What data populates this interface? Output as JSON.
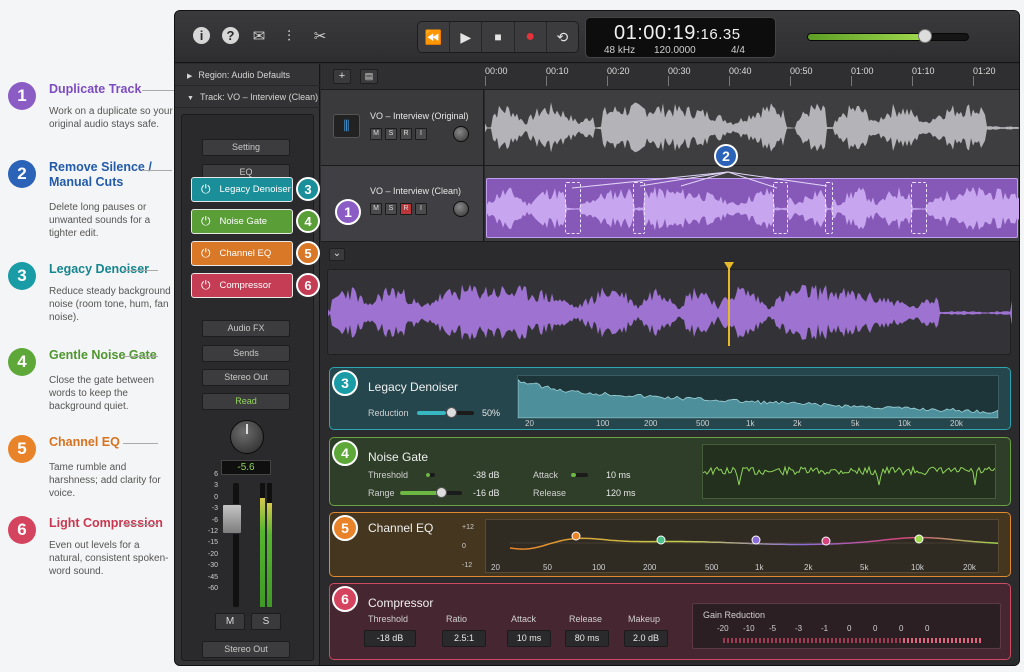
{
  "guide": [
    {
      "num": "1",
      "title": "Duplicate Track",
      "desc": "Work on a duplicate so your original audio stays safe.",
      "color": "#8c5cc5",
      "tcolor": "#7c4cc0"
    },
    {
      "num": "2",
      "title": "Remove Silence / Manual Cuts",
      "desc": "Delete long pauses or unwanted sounds for a tighter edit.",
      "color": "#2a63b7",
      "tcolor": "#235ba8"
    },
    {
      "num": "3",
      "title": "Legacy Denoiser",
      "desc": "Reduce steady background noise (room tone, hum, fan noise).",
      "color": "#1a9ca6",
      "tcolor": "#16858f"
    },
    {
      "num": "4",
      "title": "Gentle Noise Gate",
      "desc": "Close the gate between words to keep the background quiet.",
      "color": "#5ea83a",
      "tcolor": "#4f9530"
    },
    {
      "num": "5",
      "title": "Channel EQ",
      "desc": "Tame rumble and harshness; add clarity for voice.",
      "color": "#e8832a",
      "tcolor": "#d67320"
    },
    {
      "num": "6",
      "title": "Light Compression",
      "desc": "Even out levels for a natural, consistent spoken-word sound.",
      "color": "#d5445e",
      "tcolor": "#c93850"
    }
  ],
  "toolbar": {
    "icons": [
      "info-icon",
      "help-icon",
      "mail-icon",
      "mixer-icon",
      "scissors-icon"
    ],
    "info": "i",
    "help": "?",
    "mail": "✉",
    "mixer": "⫶",
    "scissors": "✂",
    "transport": {
      "rewind": "⏪",
      "play": "▶",
      "stop": "■",
      "record": "●",
      "cycle": "⟲"
    }
  },
  "lcd": {
    "time_main": "01:00:19",
    "time_frac": ":16.35",
    "sample_rate": "48 kHz",
    "tempo": "120.0000",
    "signature": "4/4"
  },
  "volume": {
    "level": 0.72
  },
  "inspector": {
    "region": "Region: Audio Defaults",
    "track": "Track:  VO – Interview (Clean)",
    "setting": "Setting",
    "eq": "EQ",
    "audio_fx": "Audio FX",
    "sends": "Sends",
    "stereo_out": "Stereo Out",
    "read": "Read",
    "pan_value": "-5.6",
    "scale": [
      "6",
      "3",
      "0",
      "-3",
      "-6",
      "-12",
      "-15",
      "-20",
      "-30",
      "-45",
      "-60"
    ],
    "mute": "M",
    "solo": "S",
    "output": "Stereo Out",
    "plugins": [
      {
        "label": "Legacy Denoiser",
        "num": "3",
        "color": "#1a8f99"
      },
      {
        "label": "Noise Gate",
        "num": "4",
        "color": "#5a9e37"
      },
      {
        "label": "Channel EQ",
        "num": "5",
        "color": "#d97826"
      },
      {
        "label": "Compressor",
        "num": "6",
        "color": "#c43d55"
      }
    ],
    "power": "⏻",
    "badge_colors": [
      "#1a9ca6",
      "#5ea83a",
      "#e8832a",
      "#d5445e"
    ]
  },
  "ruler": [
    "00:00",
    "00:10",
    "00:20",
    "00:30",
    "00:40",
    "00:50",
    "01:00",
    "01:10",
    "01:20"
  ],
  "tracks": [
    {
      "name": "VO – Interview (Original)",
      "btns": [
        "M",
        "S",
        "R",
        "I"
      ]
    },
    {
      "name": "VO – Interview (Clean)",
      "btns": [
        "M",
        "S",
        "R",
        "I"
      ],
      "badge": "1"
    }
  ],
  "cuts_badge": "2",
  "add": "+",
  "list": "▤",
  "collapse": "⌄",
  "denoiser": {
    "num": "3",
    "title": "Legacy Denoiser",
    "reduction_label": "Reduction",
    "reduction_value": "50%",
    "reduction": 0.5,
    "freqs": [
      "20",
      "100",
      "200",
      "500",
      "1k",
      "2k",
      "5k",
      "10k",
      "20k"
    ]
  },
  "gate": {
    "num": "4",
    "title": "Noise Gate",
    "threshold_label": "Threshold",
    "threshold_value": "-38 dB",
    "range_label": "Range",
    "range_value": "-16 dB",
    "attack_label": "Attack",
    "attack_value": "10 ms",
    "release_label": "Release",
    "release_value": "120 ms"
  },
  "eq": {
    "num": "5",
    "title": "Channel EQ",
    "db": [
      "+12",
      "0",
      "-12"
    ],
    "freqs": [
      "20",
      "50",
      "100",
      "200",
      "500",
      "1k",
      "2k",
      "5k",
      "10k",
      "20k"
    ]
  },
  "comp": {
    "num": "6",
    "title": "Compressor",
    "params": [
      {
        "label": "Threshold",
        "value": "-18 dB"
      },
      {
        "label": "Ratio",
        "value": "2.5:1"
      },
      {
        "label": "Attack",
        "value": "10 ms"
      },
      {
        "label": "Release",
        "value": "80 ms"
      },
      {
        "label": "Makeup",
        "value": "2.0 dB"
      }
    ],
    "gr_label": "Gain Reduction",
    "gr_scale": [
      "-20",
      "-10",
      "-5",
      "-3",
      "-1",
      "0",
      "0",
      "0",
      "0"
    ]
  }
}
